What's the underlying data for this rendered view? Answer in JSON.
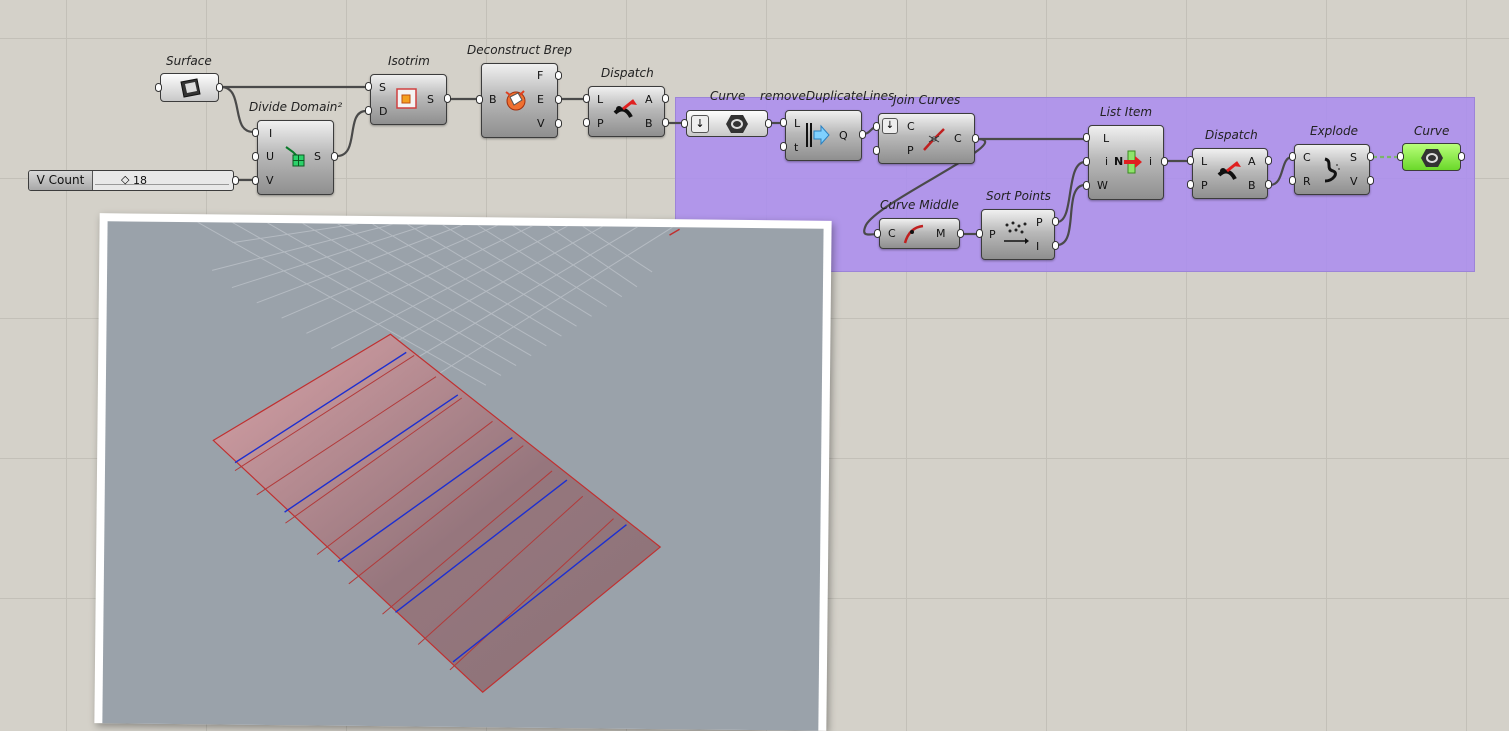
{
  "canvas": {
    "group_color": "#ab8cf0",
    "wire_color": "#4a4a4a"
  },
  "components": {
    "surface": {
      "title": "Surface",
      "icon": "surface-param-icon"
    },
    "divide_domain": {
      "title": "Divide Domain²",
      "inputs": [
        "I",
        "U",
        "V"
      ],
      "outputs": [
        "S"
      ],
      "icon": "divide-domain-icon"
    },
    "isotrim": {
      "title": "Isotrim",
      "inputs": [
        "S",
        "D"
      ],
      "outputs": [
        "S"
      ],
      "icon": "isotrim-icon"
    },
    "deconstruct_brep": {
      "title": "Deconstruct Brep",
      "inputs": [
        "B"
      ],
      "outputs": [
        "F",
        "E",
        "V"
      ],
      "icon": "deconstruct-brep-icon"
    },
    "dispatch1": {
      "title": "Dispatch",
      "inputs": [
        "L",
        "P"
      ],
      "outputs": [
        "A",
        "B"
      ],
      "icon": "dispatch-icon"
    },
    "curve_param": {
      "title": "Curve",
      "icon": "curve-param-icon"
    },
    "remove_dup": {
      "title": "removeDuplicateLines",
      "inputs": [
        "L",
        "t"
      ],
      "outputs": [
        "Q"
      ],
      "icon": "remove-duplicate-icon"
    },
    "join_curves": {
      "title": "Join Curves",
      "inputs": [
        "C",
        "P"
      ],
      "outputs": [
        "C"
      ],
      "icon": "join-curves-icon"
    },
    "list_item": {
      "title": "List Item",
      "inputs": [
        "L",
        "i",
        "W"
      ],
      "outputs": [
        "i"
      ],
      "inner_label": "N",
      "icon": "list-item-icon"
    },
    "dispatch2": {
      "title": "Dispatch",
      "inputs": [
        "L",
        "P"
      ],
      "outputs": [
        "A",
        "B"
      ],
      "icon": "dispatch-icon"
    },
    "explode": {
      "title": "Explode",
      "inputs": [
        "C",
        "R"
      ],
      "outputs": [
        "S",
        "V"
      ],
      "icon": "explode-icon"
    },
    "curve_out": {
      "title": "Curve",
      "icon": "curve-output-icon"
    },
    "curve_middle": {
      "title": "Curve Middle",
      "inputs": [
        "C"
      ],
      "outputs": [
        "M"
      ],
      "icon": "curve-middle-icon"
    },
    "sort_points": {
      "title": "Sort Points",
      "inputs": [
        "P"
      ],
      "outputs": [
        "P",
        "I"
      ],
      "icon": "sort-points-icon"
    }
  },
  "slider": {
    "label": "V Count",
    "value": "18"
  },
  "viewport": {
    "background": "#9aa2aa",
    "surface_color": "#c88c8f",
    "edge_color": "#c03030",
    "curve_color": "#1d2fd0",
    "strip_count": 9
  }
}
